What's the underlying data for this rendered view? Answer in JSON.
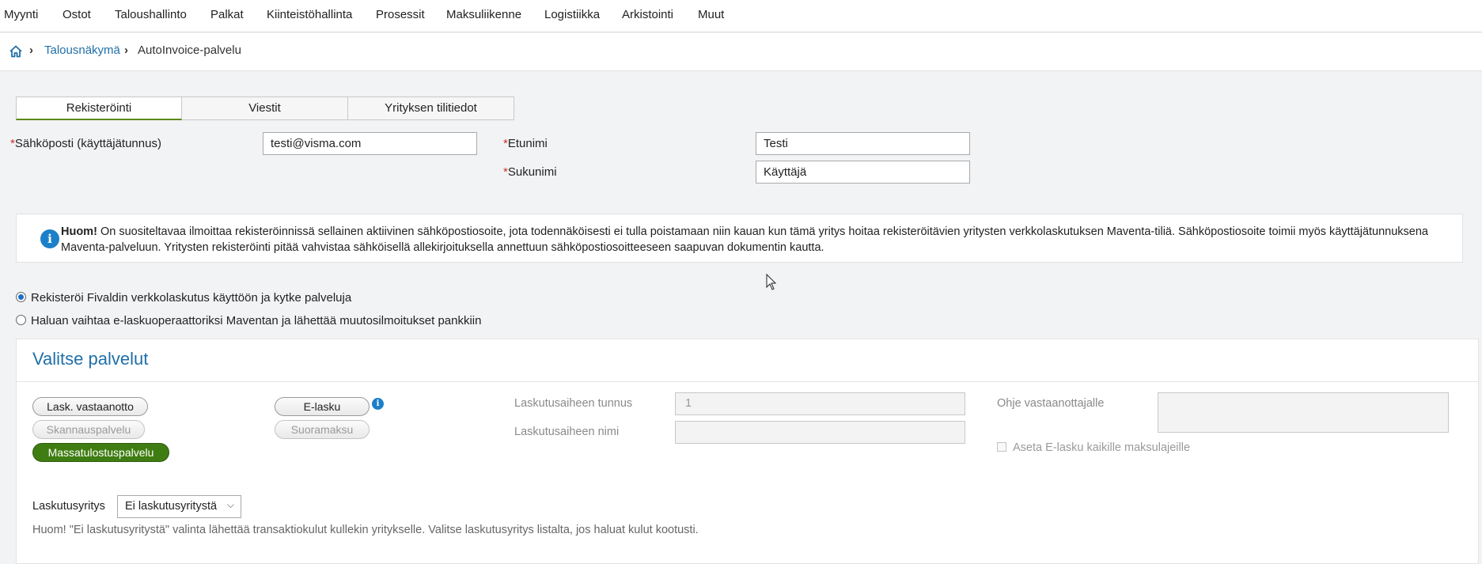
{
  "topnav": {
    "items": [
      "Myynti",
      "Ostot",
      "Taloushallinto",
      "Palkat",
      "Kiinteistöhallinta",
      "Prosessit",
      "Maksuliikenne",
      "Logistiikka",
      "Arkistointi",
      "Muut"
    ]
  },
  "breadcrumb": {
    "home_icon": "home-icon",
    "link": "Talousnäkymä",
    "current": "AutoInvoice-palvelu"
  },
  "tabs": [
    "Rekisteröinti",
    "Viestit",
    "Yrityksen tilitiedot"
  ],
  "form": {
    "required_mark": "*",
    "email_label": "Sähköposti (käyttäjätunnus)",
    "email_value": "testi@visma.com",
    "firstname_label": "Etunimi",
    "firstname_value": "Testi",
    "lastname_label": "Sukunimi",
    "lastname_value": "Käyttäjä"
  },
  "info": {
    "icon": "info-icon",
    "bold": "Huom!",
    "text": " On suositeltavaa ilmoittaa rekisteröinnissä sellainen aktiivinen sähköpostiosoite, jota todennäköisesti ei tulla poistamaan niin kauan kun tämä yritys hoitaa rekisteröitävien yritysten verkkolaskutuksen Maventa-tiliä. Sähköpostiosoite toimii myös käyttäjätunnuksena Maventa-palveluun. Yritysten rekisteröinti pitää vahvistaa sähköisellä allekirjoituksella annettuun sähköpostiosoitteeseen saapuvan dokumentin kautta."
  },
  "radios": [
    {
      "label": "Rekisteröi Fivaldin verkkolaskutus käyttöön ja kytke palveluja",
      "checked": true
    },
    {
      "label": "Haluan vaihtaa e-laskuoperaattoriksi Maventan ja lähettää muutosilmoitukset pankkiin",
      "checked": false
    }
  ],
  "services": {
    "title": "Valitse palvelut",
    "buttons": {
      "receive": "Lask. vastaanotto",
      "elasku": "E-lasku",
      "scan": "Skannauspalvelu",
      "direct": "Suoramaksu",
      "mass_print": "Massatulostuspalvelu"
    },
    "billing_id_label": "Laskutusaiheen tunnus",
    "billing_id_value": "1",
    "billing_name_label": "Laskutusaiheen nimi",
    "billing_name_value": "",
    "instructions_label": "Ohje vastaanottajalle",
    "checkbox_label": "Aseta E-lasku kaikille maksulajeille",
    "billing_company_label": "Laskutusyritys",
    "billing_company_value": "Ei laskutusyritystä",
    "note": "Huom! \"Ei laskutusyritystä\" valinta lähettää transaktiokulut kullekin yritykselle. Valitse laskutusyritys listalta, jos haluat kulut kootusti."
  },
  "colors": {
    "accent_blue": "#1f6fa8",
    "selected_green": "#3f7d12",
    "required_red": "#c9302c"
  }
}
